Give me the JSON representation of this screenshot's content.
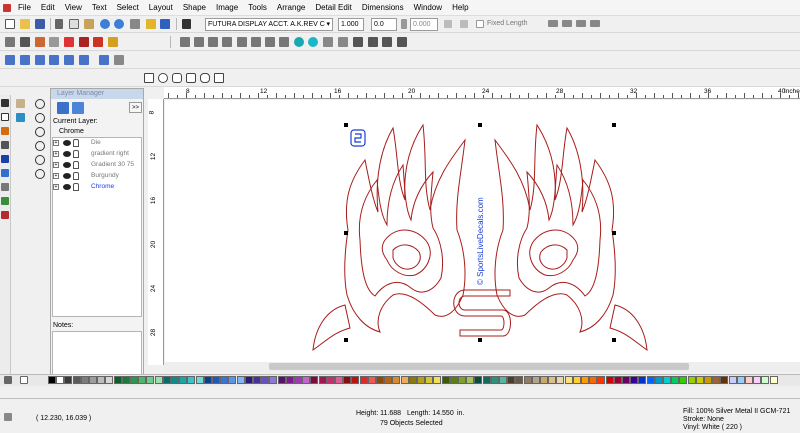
{
  "menu": [
    "File",
    "Edit",
    "View",
    "Text",
    "Select",
    "Layout",
    "Shape",
    "Image",
    "Tools",
    "Arrange",
    "Detail Edit",
    "Dimensions",
    "Window",
    "Help"
  ],
  "toolbar": {
    "font_name": "FUTURA DISPLAY ACCT. A.K.REV C",
    "font_size": "1.000",
    "char_spacing": "0.0",
    "slant": "0.000",
    "fixed_length_label": "Fixed Length"
  },
  "layer_manager": {
    "title": "Layer Manager",
    "current_layer_label": "Current Layer:",
    "current_layer": "Chrome",
    "expand_button": ">>",
    "layers": [
      {
        "name": "Die",
        "color": "#777777"
      },
      {
        "name": "gradient right",
        "color": "#777777"
      },
      {
        "name": "Gradient 30 75",
        "color": "#777777"
      },
      {
        "name": "Burgundy",
        "color": "#777777"
      },
      {
        "name": "Chrome",
        "color": "#1a3fd6"
      }
    ],
    "notes_label": "Notes:"
  },
  "ruler": {
    "top": [
      "8",
      "12",
      "16",
      "20",
      "24",
      "28",
      "32",
      "36",
      "40",
      "Inche"
    ],
    "left": [
      "8",
      "12",
      "16",
      "20",
      "24",
      "28"
    ]
  },
  "canvas": {
    "vertical_text": "© SportsLiveDecals.com",
    "logo_text": "S",
    "line_color": "#a81c1c",
    "text_color": "#1a3fd6"
  },
  "palette": [
    "#000000",
    "#ffffff",
    "#3a3a3a",
    "#5a5a5a",
    "#7b7b7b",
    "#9c9c9c",
    "#bdbdbd",
    "#d7d7d7",
    "#0b5f2a",
    "#1b7a3a",
    "#2f9650",
    "#4db56c",
    "#6fcc87",
    "#9fdcae",
    "#0a6b6b",
    "#0f8a8a",
    "#14a8a8",
    "#37c4c4",
    "#6fd8d8",
    "#0b3d91",
    "#1f57b8",
    "#3973d6",
    "#5b93e8",
    "#86b3f2",
    "#2c1a7a",
    "#47309a",
    "#6a4fc0",
    "#8f78d8",
    "#5a0f6b",
    "#7d1c91",
    "#a236b3",
    "#c463cf",
    "#7a0b3d",
    "#a21452",
    "#c92d6e",
    "#e05b93",
    "#8a0b0b",
    "#b51414",
    "#d92b2b",
    "#f05858",
    "#8a4a0b",
    "#b56414",
    "#d98a2b",
    "#f0aa58",
    "#8a7a0b",
    "#b5a114",
    "#d9c52b",
    "#f0e058",
    "#3d5a0b",
    "#5a7d14",
    "#7ea12b",
    "#a3c458",
    "#0b4a3d",
    "#146b5a",
    "#2b917d",
    "#58b5a3",
    "#4a3d2c",
    "#6b5a45",
    "#917d63",
    "#b5a38c",
    "#c8a86b",
    "#dcc08c",
    "#e8d6b0",
    "#ffe07a",
    "#ffcc33",
    "#ff9900",
    "#ff6600",
    "#ff3300",
    "#cc0000",
    "#990033",
    "#660066",
    "#330099",
    "#0033cc",
    "#0066ff",
    "#0099cc",
    "#00cccc",
    "#00cc66",
    "#33cc00",
    "#99cc00",
    "#cccc00",
    "#cc9900",
    "#996633",
    "#663300",
    "#ccccff",
    "#99ccff",
    "#ffcccc",
    "#ffccff",
    "#ccffcc",
    "#ffffcc"
  ],
  "status": {
    "coords": "( 12.230, 16.039 )",
    "height": "Height: 11.688",
    "length": "Length: 14.550",
    "units": "in.",
    "selected": "79 Objects Selected",
    "fill": "Fill: 100% Silver Metal II GCM-721",
    "stroke": "Stroke: None",
    "vinyl": "Vinyl: White ( 220 )"
  }
}
